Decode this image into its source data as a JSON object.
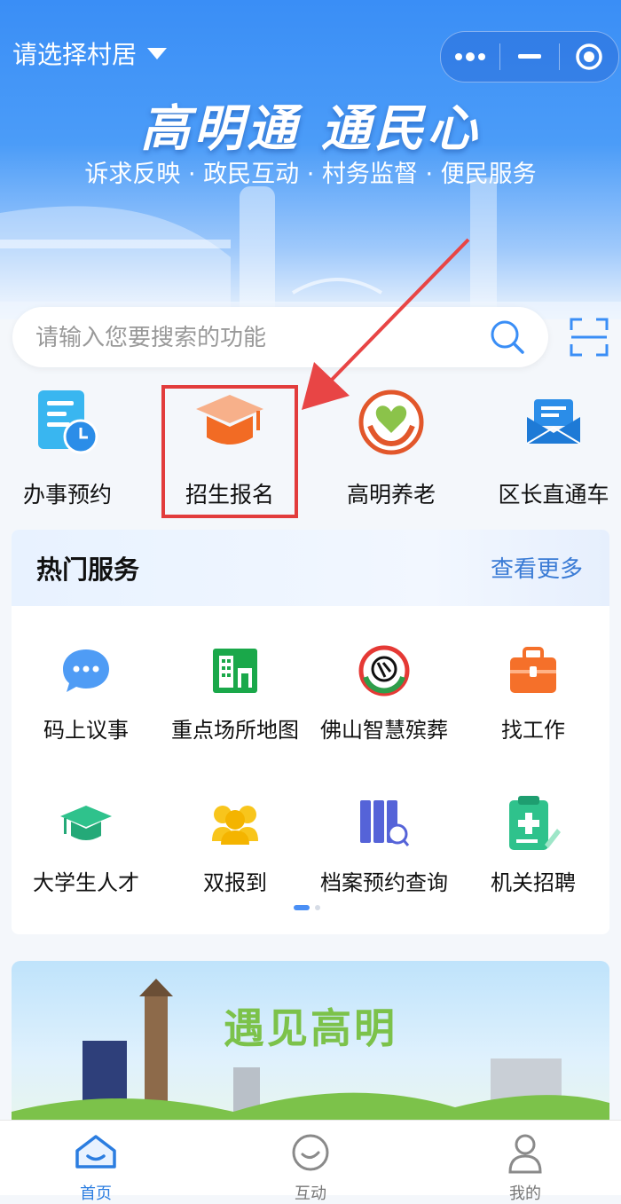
{
  "header": {
    "location_label": "请选择村居"
  },
  "hero": {
    "slogan": "高明通 通民心",
    "subtitle": "诉求反映 · 政民互动 · 村务监督 · 便民服务"
  },
  "search": {
    "placeholder": "请输入您要搜索的功能"
  },
  "quick_entries": [
    {
      "label": "办事预约",
      "icon": "calendar-clock-icon"
    },
    {
      "label": "招生报名",
      "icon": "graduation-cap-icon"
    },
    {
      "label": "高明养老",
      "icon": "elderly-care-icon"
    },
    {
      "label": "区长直通车",
      "icon": "mail-envelope-icon"
    }
  ],
  "hot_services": {
    "title": "热门服务",
    "more_label": "查看更多",
    "items": [
      {
        "label": "码上议事",
        "icon": "chat-bubble-icon"
      },
      {
        "label": "重点场所地图",
        "icon": "building-map-icon"
      },
      {
        "label": "佛山智慧殡葬",
        "icon": "funeral-logo-icon"
      },
      {
        "label": "找工作",
        "icon": "briefcase-icon"
      },
      {
        "label": "大学生人才",
        "icon": "graduate-cap-icon"
      },
      {
        "label": "双报到",
        "icon": "people-group-icon"
      },
      {
        "label": "档案预约查询",
        "icon": "archive-search-icon"
      },
      {
        "label": "机关招聘",
        "icon": "clipboard-plus-icon"
      }
    ],
    "page_indicator": {
      "current": 1,
      "total": 2
    }
  },
  "banner": {
    "title": "遇见高明"
  },
  "tabbar": [
    {
      "label": "首页",
      "active": true
    },
    {
      "label": "互动",
      "active": false
    },
    {
      "label": "我的",
      "active": false
    }
  ],
  "colors": {
    "primary": "#3a8ef6",
    "highlight": "#e23c3c",
    "link": "#3a7bd5"
  }
}
